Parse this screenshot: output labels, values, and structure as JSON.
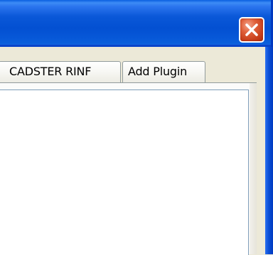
{
  "window": {
    "close_icon": "close-icon"
  },
  "tabs": [
    {
      "label": "CADSTER RINF"
    },
    {
      "label": "Add Plugin"
    }
  ],
  "colors": {
    "titlebar": "#0350d2",
    "close_button": "#e0603a",
    "face": "#ece9d8",
    "panel": "#ffffff"
  }
}
